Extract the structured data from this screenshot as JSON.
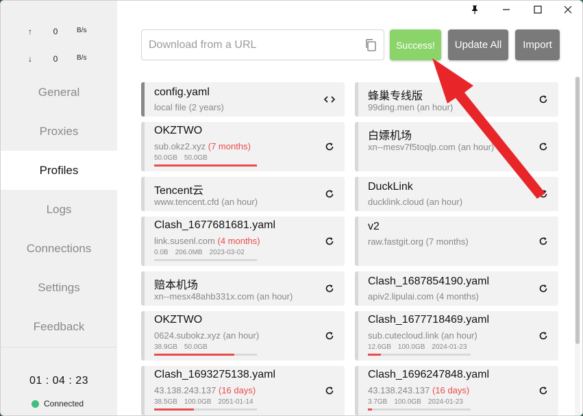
{
  "window": {
    "pin_icon": "pin-icon",
    "min_icon": "minimize-icon",
    "max_icon": "maximize-icon",
    "close_icon": "close-icon"
  },
  "traffic": {
    "up_arrow": "↑",
    "up_value": "0",
    "up_unit": "B/s",
    "down_arrow": "↓",
    "down_value": "0",
    "down_unit": "B/s"
  },
  "nav": [
    {
      "label": "General"
    },
    {
      "label": "Proxies"
    },
    {
      "label": "Profiles"
    },
    {
      "label": "Logs"
    },
    {
      "label": "Connections"
    },
    {
      "label": "Settings"
    },
    {
      "label": "Feedback"
    }
  ],
  "status": {
    "clock": "01 : 04 : 23",
    "connection": "Connected",
    "connection_color": "#3fbf7f"
  },
  "toolbar": {
    "url_placeholder": "Download from a URL",
    "success_label": "Success!",
    "update_all_label": "Update All",
    "import_label": "Import",
    "success_color": "#8bd46a",
    "button_color": "#7a7a7a"
  },
  "profiles": [
    {
      "name": "config.yaml",
      "sub": "local file (2 years)",
      "action": "code-icon"
    },
    {
      "name": "蜂巢专线版",
      "sub": "99ding.men (an hour)",
      "action": "refresh-icon"
    },
    {
      "name": "OKZTWO",
      "sub": "sub.okz2.xyz ",
      "sub_red": "(7 months)",
      "stats": [
        "50.0GB",
        "50.0GB"
      ],
      "usage": 1.0,
      "action": "refresh-icon"
    },
    {
      "name": "白嫖机场",
      "sub": "xn--mesv7f5toqlp.com (an hour)",
      "action": "refresh-icon"
    },
    {
      "name": "Tencent云",
      "sub": "www.tencent.cfd (an hour)",
      "action": "refresh-icon"
    },
    {
      "name": "DuckLink",
      "sub": "ducklink.cloud (an hour)",
      "action": "refresh-icon"
    },
    {
      "name": "Clash_1677681681.yaml",
      "sub": "link.susenl.com ",
      "sub_red": "(4 months)",
      "stats": [
        "0.0B",
        "206.0MB",
        "2023-03-02"
      ],
      "usage": 0.0,
      "action": "refresh-icon"
    },
    {
      "name": "v2",
      "sub": "raw.fastgit.org (7 months)",
      "action": "refresh-icon"
    },
    {
      "name": "赔本机场",
      "sub": "xn--mesx48ahb331x.com (an hour)",
      "action": "refresh-icon"
    },
    {
      "name": "Clash_1687854190.yaml",
      "sub": "apiv2.lipulai.com (4 months)",
      "action": "refresh-icon"
    },
    {
      "name": "OKZTWO",
      "sub": "0624.subokz.xyz (an hour)",
      "stats": [
        "38.9GB",
        "50.0GB"
      ],
      "usage": 0.78,
      "action": "refresh-icon"
    },
    {
      "name": "Clash_1677718469.yaml",
      "sub": "sub.cutecloud.link (an hour)",
      "stats": [
        "12.6GB",
        "100.0GB",
        "2024-01-23"
      ],
      "usage": 0.126,
      "action": "refresh-icon"
    },
    {
      "name": "Clash_1693275138.yaml",
      "sub": "43.138.243.137 ",
      "sub_red": "(16 days)",
      "stats": [
        "38.5GB",
        "100.0GB",
        "2051-01-14"
      ],
      "usage": 0.385,
      "action": "refresh-icon"
    },
    {
      "name": "Clash_1696247848.yaml",
      "sub": "43.138.243.137 ",
      "sub_red": "(16 days)",
      "stats": [
        "3.7GB",
        "100.0GB",
        "2024-01-23"
      ],
      "usage": 0.037,
      "action": "refresh-icon"
    }
  ],
  "annotation": {
    "arrow_color": "#e8262a"
  }
}
